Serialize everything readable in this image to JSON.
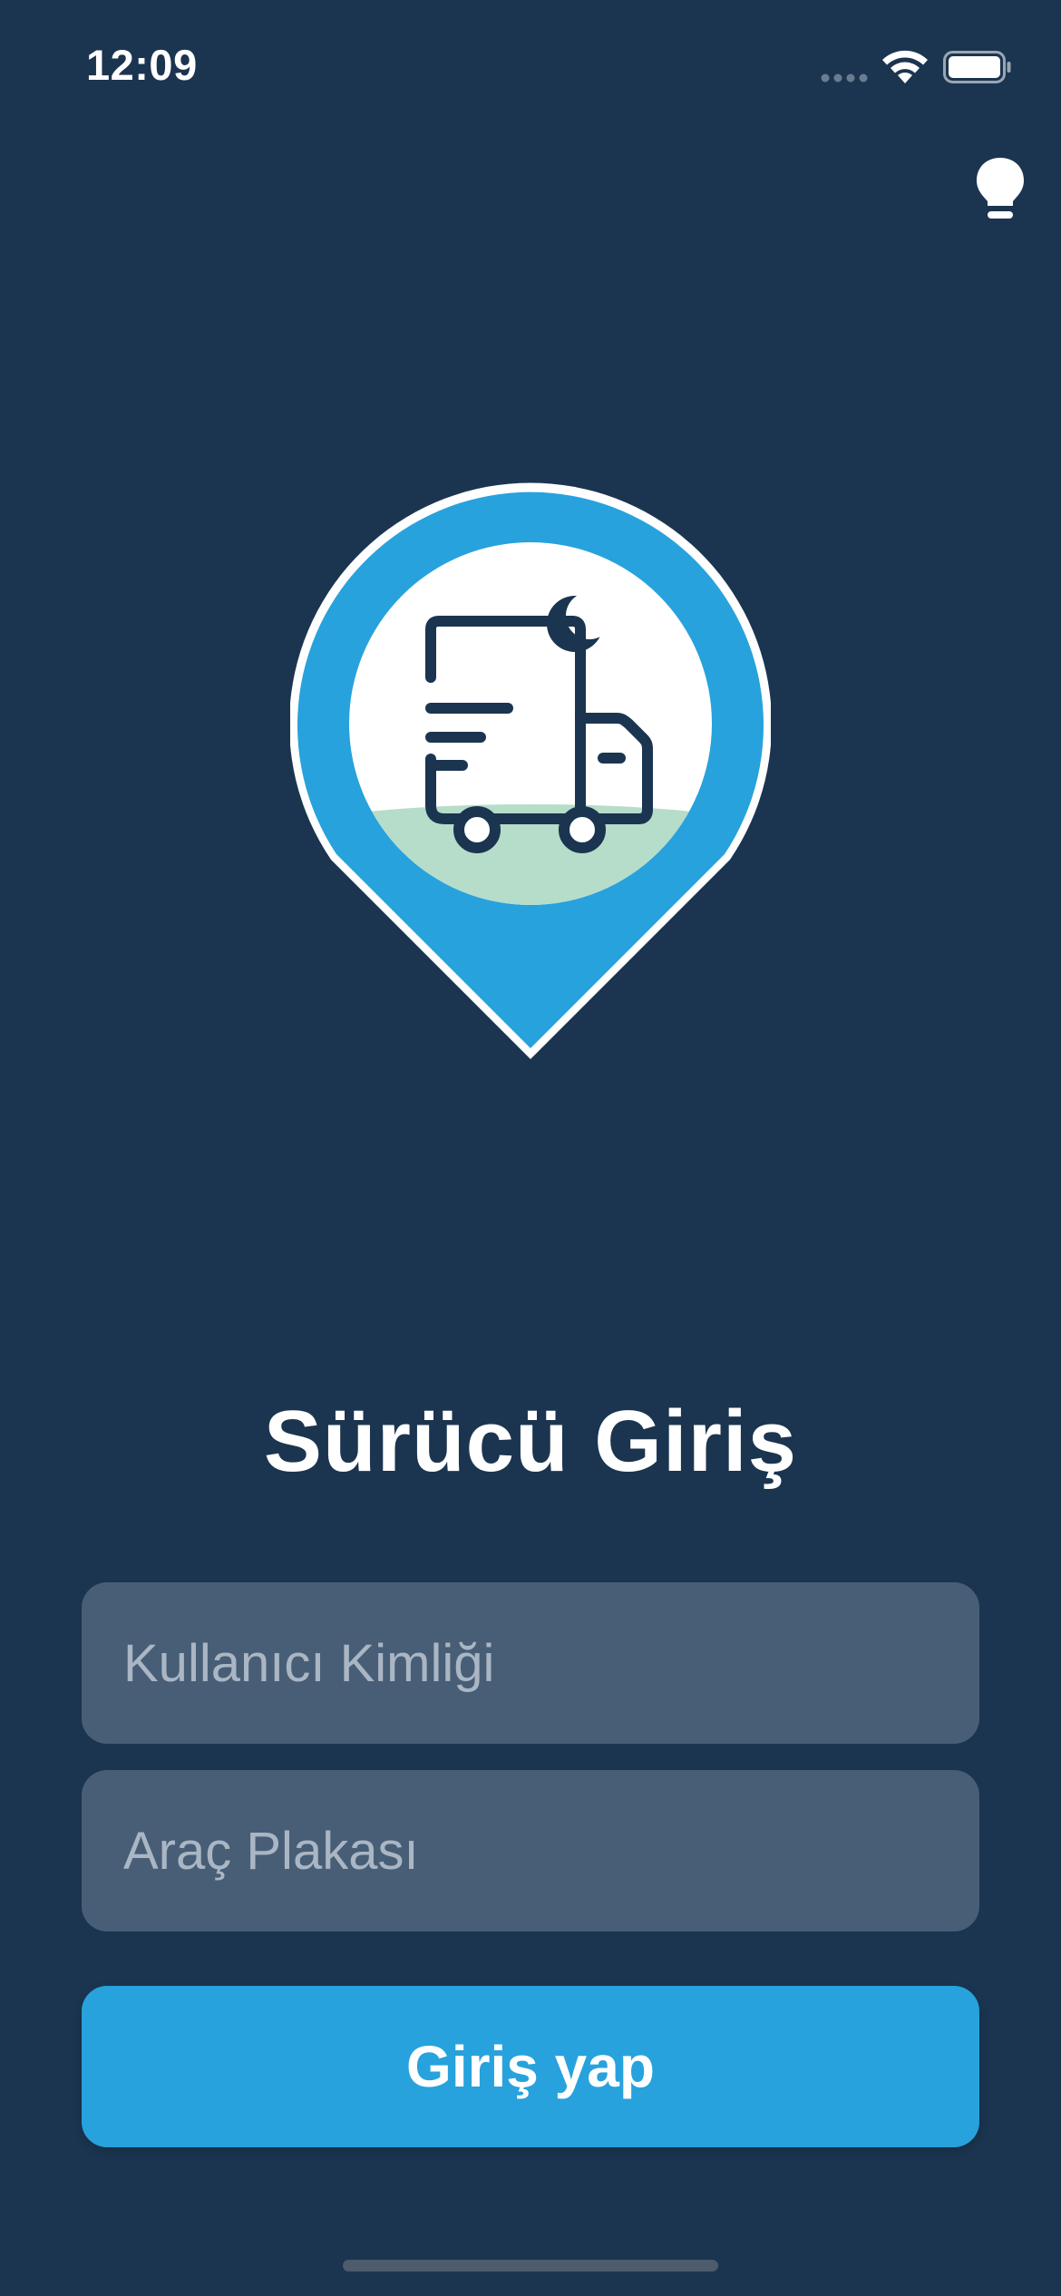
{
  "status_bar": {
    "time": "12:09"
  },
  "icons": {
    "theme_toggle": "lightbulb-icon",
    "logo": "truck-location-pin-logo",
    "signal": "cellular-signal-icon",
    "wifi": "wifi-icon",
    "battery": "battery-icon"
  },
  "colors": {
    "background": "#1b3550",
    "accent": "#27a2dd",
    "field_background": "#475e76",
    "ground": "#b6ddca"
  },
  "login": {
    "title": "Sürücü Giriş",
    "user_id_placeholder": "Kullanıcı Kimliği",
    "user_id_value": "",
    "plate_placeholder": "Araç Plakası",
    "plate_value": "",
    "submit_label": "Giriş yap"
  }
}
